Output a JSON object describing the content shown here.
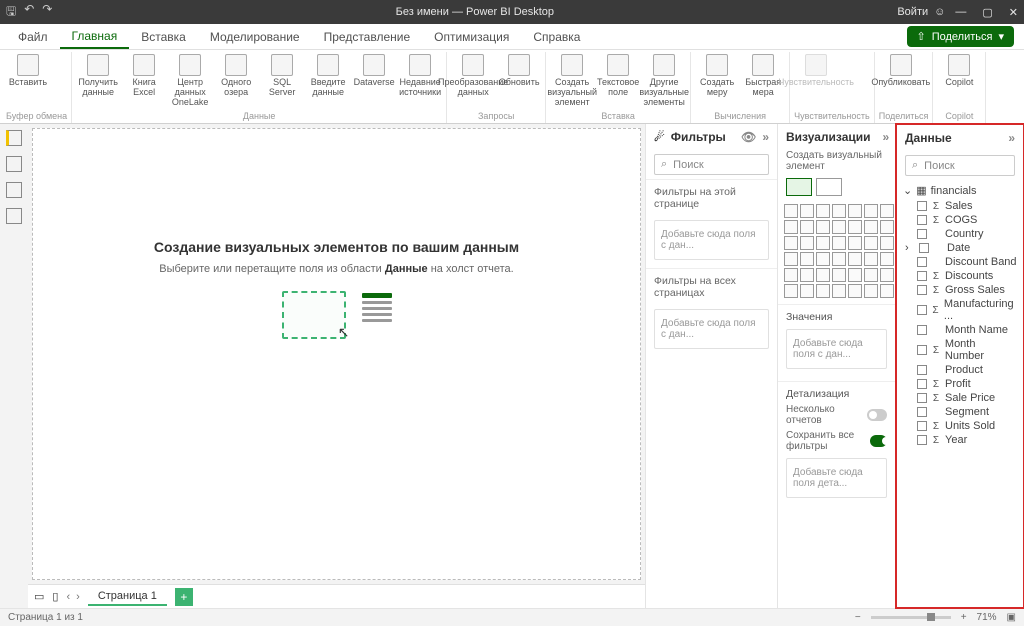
{
  "titlebar": {
    "title": "Без имени — Power BI Desktop",
    "login": "Войти"
  },
  "tabs": [
    "Файл",
    "Главная",
    "Вставка",
    "Моделирование",
    "Представление",
    "Оптимизация",
    "Справка"
  ],
  "share": "Поделиться",
  "ribbon": {
    "groups": [
      {
        "label": "Буфер обмена",
        "btns": [
          {
            "t": "Вставить"
          }
        ]
      },
      {
        "label": "Данные",
        "btns": [
          {
            "t": "Получить данные"
          },
          {
            "t": "Книга Excel"
          },
          {
            "t": "Центр данных OneLake"
          },
          {
            "t": "Одного озера"
          },
          {
            "t": "SQL Server"
          },
          {
            "t": "Введите данные"
          },
          {
            "t": "Dataverse"
          },
          {
            "t": "Недавние источники"
          }
        ]
      },
      {
        "label": "Запросы",
        "btns": [
          {
            "t": "Преобразование данных"
          },
          {
            "t": "Обновить"
          }
        ]
      },
      {
        "label": "Вставка",
        "btns": [
          {
            "t": "Создать визуальный элемент"
          },
          {
            "t": "Текстовое поле"
          },
          {
            "t": "Другие визуальные элементы"
          }
        ]
      },
      {
        "label": "Вычисления",
        "btns": [
          {
            "t": "Создать меру"
          },
          {
            "t": "Быстрая мера"
          }
        ]
      },
      {
        "label": "Чувствительность",
        "btns": [
          {
            "t": "Чувствительность",
            "dim": true
          }
        ]
      },
      {
        "label": "Поделиться",
        "btns": [
          {
            "t": "Опубликовать"
          }
        ]
      },
      {
        "label": "Copilot",
        "btns": [
          {
            "t": "Copilot"
          }
        ]
      }
    ]
  },
  "canvas": {
    "heading": "Создание визуальных элементов по вашим данным",
    "sub_a": "Выберите или перетащите поля из области ",
    "sub_b": "Данные",
    "sub_c": " на холст отчета."
  },
  "pagebar": {
    "tab": "Страница 1"
  },
  "filters": {
    "title": "Фильтры",
    "search": "Поиск",
    "on_page": "Фильтры на этой странице",
    "drop": "Добавьте сюда поля с дан...",
    "all_pages": "Фильтры на всех страницах"
  },
  "viz": {
    "title": "Визуализации",
    "sub": "Создать визуальный элемент",
    "values": "Значения",
    "drop": "Добавьте сюда поля с дан...",
    "drill": "Детализация",
    "multi": "Несколько отчетов",
    "keep": "Сохранить все фильтры",
    "drop2": "Добавьте сюда поля дета..."
  },
  "data": {
    "title": "Данные",
    "search": "Поиск",
    "table": "financials",
    "fields": [
      {
        "n": " Sales",
        "s": "Σ"
      },
      {
        "n": "COGS",
        "s": "Σ"
      },
      {
        "n": "Country",
        "s": ""
      },
      {
        "n": "Date",
        "s": "",
        "exp": true
      },
      {
        "n": "Discount Band",
        "s": ""
      },
      {
        "n": "Discounts",
        "s": "Σ"
      },
      {
        "n": "Gross Sales",
        "s": "Σ"
      },
      {
        "n": "Manufacturing ...",
        "s": "Σ"
      },
      {
        "n": "Month Name",
        "s": ""
      },
      {
        "n": "Month Number",
        "s": "Σ"
      },
      {
        "n": "Product",
        "s": ""
      },
      {
        "n": "Profit",
        "s": "Σ"
      },
      {
        "n": "Sale Price",
        "s": "Σ"
      },
      {
        "n": "Segment",
        "s": ""
      },
      {
        "n": "Units Sold",
        "s": "Σ"
      },
      {
        "n": "Year",
        "s": "Σ"
      }
    ]
  },
  "status": {
    "page": "Страница 1 из 1",
    "zoom": "71%"
  }
}
